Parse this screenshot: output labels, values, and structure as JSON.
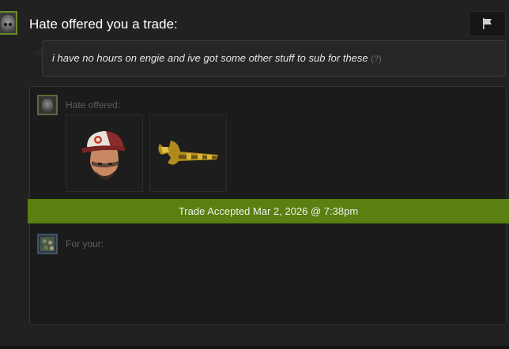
{
  "header": {
    "title": "Hate offered you a trade:"
  },
  "message": {
    "text": "i have no hours on engie and ive got some other stuff to sub for these",
    "help_link": "(?)"
  },
  "offer": {
    "offered_label": "Hate offered:",
    "items": [
      {
        "icon": "soldier-head-cap-icon"
      },
      {
        "icon": "golden-wrench-icon"
      }
    ]
  },
  "status": {
    "text": "Trade Accepted Mar 2, 2026 @ 7:38pm",
    "color": "#5b7f10"
  },
  "receive": {
    "for_label": "For your:"
  },
  "colors": {
    "background": "#212121",
    "panel": "#1b1b1b",
    "accent_green": "#5b7f10",
    "avatar_border": "#6b8a2a"
  }
}
